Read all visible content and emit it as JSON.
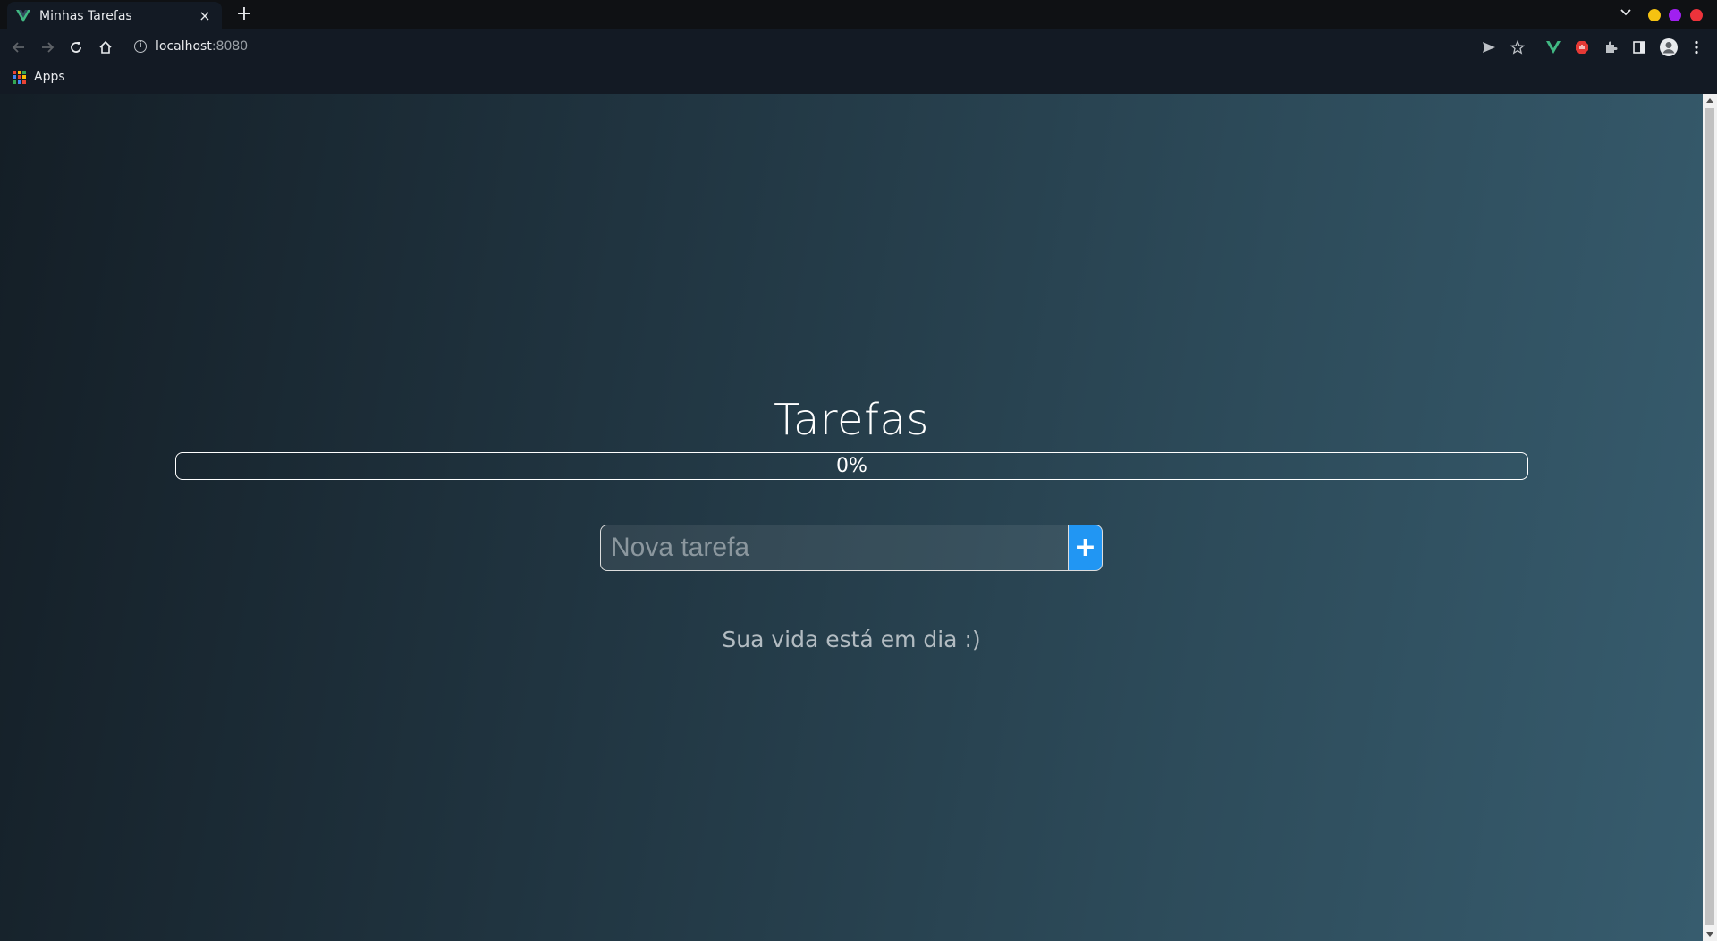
{
  "browser": {
    "tab_title": "Minhas Tarefas",
    "new_tab": "+",
    "tab_close": "×",
    "url_host": "localhost",
    "url_port": ":8080",
    "bookmark_apps": "Apps"
  },
  "app": {
    "title": "Tarefas",
    "progress_label": "0%",
    "progress_value": 0,
    "new_task_placeholder": "Nova tarefa",
    "add_button": "+",
    "empty_message": "Sua vida está em dia :)"
  },
  "colors": {
    "accent": "#2196f3",
    "vue_green": "#41b883"
  }
}
